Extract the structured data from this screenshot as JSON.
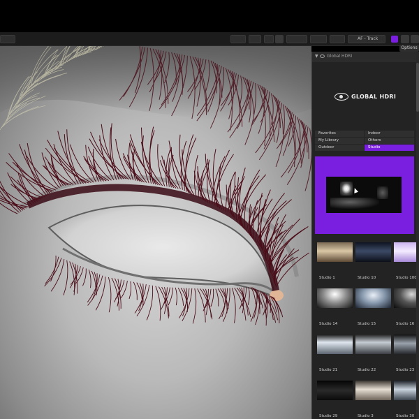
{
  "toolbar": {
    "mode_label": "AF - Track",
    "options_label": "Options"
  },
  "panel": {
    "title": "Global HDRI",
    "logo_text": "GLOBAL HDRI",
    "categories": [
      {
        "label": "Favorites",
        "active": false
      },
      {
        "label": "Indoor",
        "active": false
      },
      {
        "label": "My Library",
        "active": false
      },
      {
        "label": "Others",
        "active": false
      },
      {
        "label": "Outdoor",
        "active": false
      },
      {
        "label": "Studio",
        "active": true
      }
    ],
    "accent_color": "#7a1fe0",
    "hdri_items": [
      {
        "label": "Studio 1",
        "thumb": "warm"
      },
      {
        "label": "Studio 10",
        "thumb": "dark-blue"
      },
      {
        "label": "Studio 100",
        "thumb": "violet"
      },
      {
        "label": "Studio 14",
        "thumb": "dome-bright"
      },
      {
        "label": "Studio 15",
        "thumb": "dome-blue"
      },
      {
        "label": "Studio 16",
        "thumb": "dome-dark"
      },
      {
        "label": "Studio 21",
        "thumb": "room-white"
      },
      {
        "label": "Studio 22",
        "thumb": "room-grey"
      },
      {
        "label": "Studio 23",
        "thumb": "room-dim"
      },
      {
        "label": "Studio 29",
        "thumb": "night"
      },
      {
        "label": "Studio 3",
        "thumb": "hall"
      },
      {
        "label": "Studio 30",
        "thumb": "lab"
      }
    ]
  },
  "viewport": {
    "subject": "eye-render",
    "lash_color": "#5a0f1c"
  }
}
